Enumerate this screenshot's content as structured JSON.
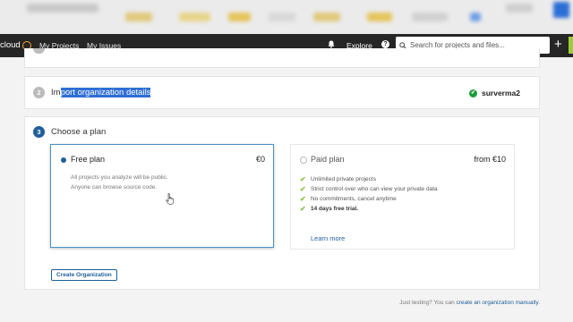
{
  "topbar": {
    "logo_text": "cloud",
    "nav_items": [
      "My Projects",
      "My Issues"
    ],
    "explore_label": "Explore",
    "help_glyph": "?",
    "search_placeholder": "Search for projects and files...",
    "plus_glyph": "+"
  },
  "steps": {
    "step2": {
      "number": "2",
      "title_pre": "Im",
      "title_selected": "port organization details",
      "organization": "surverma2",
      "status_icon": "check-circle-icon"
    },
    "step3": {
      "number": "3",
      "title": "Choose a plan"
    }
  },
  "plans": {
    "free": {
      "name": "Free plan",
      "price": "€0",
      "desc_line1": "All projects you analyze will be public.",
      "desc_line2": "Anyone can browse source code.",
      "selected": true
    },
    "paid": {
      "name": "Paid plan",
      "price": "from €10",
      "features": [
        "Unlimited private projects",
        "Strict control over who can view your private data",
        "No commitments, cancel anytime",
        "14 days free trial."
      ],
      "learn_more": "Learn more",
      "selected": false
    }
  },
  "create_button": "Create Organization",
  "footer": {
    "prefix": "Just testing? You can ",
    "link": "create an organization manually",
    "suffix": "."
  },
  "colors": {
    "topbar_bg": "#262626",
    "accent": "#1f5f99",
    "selection": "#2f6fd6",
    "success": "#1c9c3c",
    "check": "#8bc34a"
  }
}
